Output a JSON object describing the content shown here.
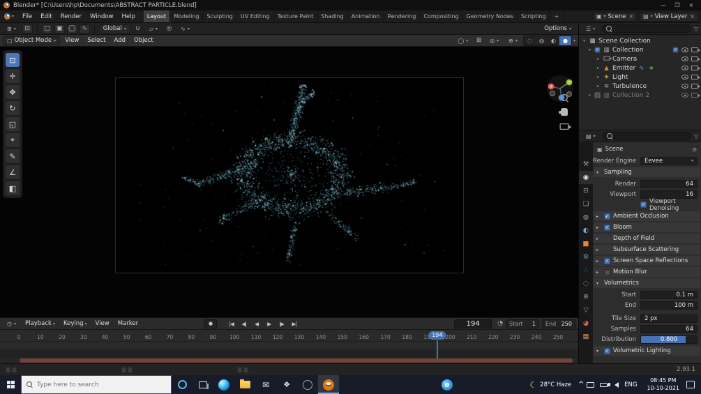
{
  "titlebar": {
    "title": "Blender* [C:\\Users\\hp\\Documents\\ABSTRACT PARTICLE.blend]"
  },
  "menubar": {
    "menus": [
      "File",
      "Edit",
      "Render",
      "Window",
      "Help"
    ],
    "workspaces": [
      "Layout",
      "Modeling",
      "Sculpting",
      "UV Editing",
      "Texture Paint",
      "Shading",
      "Animation",
      "Rendering",
      "Compositing",
      "Geometry Nodes",
      "Scripting"
    ],
    "active_workspace": "Layout",
    "add_tab": "+",
    "scene": "Scene",
    "view_layer": "View Layer"
  },
  "tool_settings": {
    "orientation": "Global",
    "options": "Options"
  },
  "viewport": {
    "mode": "Object Mode",
    "menus": [
      "View",
      "Select",
      "Add",
      "Object"
    ],
    "particle_colors": [
      "#d8f6ff",
      "#8fdcef",
      "#3f93b8"
    ],
    "background": "#000000"
  },
  "outliner": {
    "rows": [
      {
        "label": "Scene Collection"
      },
      {
        "label": "Collection"
      },
      {
        "label": "Camera"
      },
      {
        "label": "Emitter"
      },
      {
        "label": "Light"
      },
      {
        "label": "Turbulence"
      },
      {
        "label": "Collection 2"
      }
    ]
  },
  "properties": {
    "breadcrumb": "Scene",
    "render_engine_label": "Render Engine",
    "render_engine_value": "Eevee",
    "sampling_title": "Sampling",
    "sampling_rows": [
      {
        "label": "Render",
        "value": "64"
      },
      {
        "label": "Viewport",
        "value": "16"
      }
    ],
    "denoising_label": "Viewport Denoising",
    "panels": [
      {
        "title": "Ambient Occlusion",
        "checkbox": true,
        "checked": true
      },
      {
        "title": "Bloom",
        "checkbox": true,
        "checked": true
      },
      {
        "title": "Depth of Field",
        "checkbox": false
      },
      {
        "title": "Subsurface Scattering",
        "checkbox": false
      },
      {
        "title": "Screen Space Reflections",
        "checkbox": true,
        "checked": true
      },
      {
        "title": "Motion Blur",
        "checkbox": true,
        "checked": false
      }
    ],
    "volumetrics_title": "Volumetrics",
    "volumetrics_rows": [
      {
        "label": "Start",
        "value": "0.1 m"
      },
      {
        "label": "End",
        "value": "100 m"
      },
      {
        "label": "Tile Size",
        "value": "2 px"
      },
      {
        "label": "Samples",
        "value": "64"
      }
    ],
    "distribution_label": "Distribution",
    "distribution_value": "0.800",
    "volumetric_lighting_label": "Volumetric Lighting"
  },
  "timeline": {
    "menus": [
      "Playback",
      "Keying",
      "View",
      "Marker"
    ],
    "icons": {
      "record": "●",
      "jump_start": "|◀",
      "prev_key": "◀|",
      "play_rev": "◀",
      "play": "▶",
      "next_key": "|▶",
      "jump_end": "▶|"
    },
    "current_frame": "194",
    "frame_start_label": "Start",
    "frame_start": "1",
    "frame_end_label": "End",
    "frame_end": "250",
    "tick_step": 10,
    "tick_max": 250
  },
  "statusbar": {
    "version": "2.93.1"
  },
  "taskbar": {
    "search_placeholder": "Type here to search",
    "weather": "28°C Haze",
    "language": "ENG",
    "time": "08:45 PM",
    "date": "10-10-2021"
  },
  "colors": {
    "accent": "#4772b3",
    "object_orange": "#e87d0d",
    "particle": "#8fdcef"
  }
}
